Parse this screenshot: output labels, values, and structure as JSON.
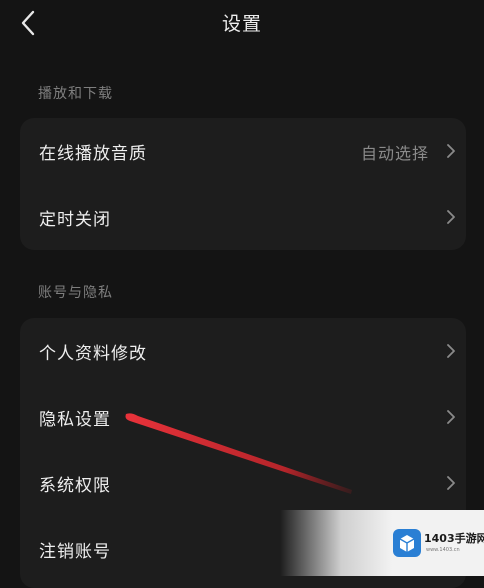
{
  "header": {
    "title": "设置",
    "back_icon": "chevron-left-icon"
  },
  "sections": [
    {
      "title": "播放和下载",
      "items": [
        {
          "label": "在线播放音质",
          "value": "自动选择"
        },
        {
          "label": "定时关闭"
        }
      ]
    },
    {
      "title": "账号与隐私",
      "items": [
        {
          "label": "个人资料修改"
        },
        {
          "label": "隐私设置"
        },
        {
          "label": "系统权限"
        },
        {
          "label": "注销账号"
        }
      ]
    }
  ],
  "icons": {
    "row_chevron": "chevron-right-icon"
  },
  "colors": {
    "background": "#141414",
    "card": "#1d1d1d",
    "text": "#eeeeee",
    "muted": "#7e7e7e",
    "annotation": "#e8323a"
  },
  "watermark": {
    "text": "1403手游网",
    "sub": "www.1403.cn"
  }
}
